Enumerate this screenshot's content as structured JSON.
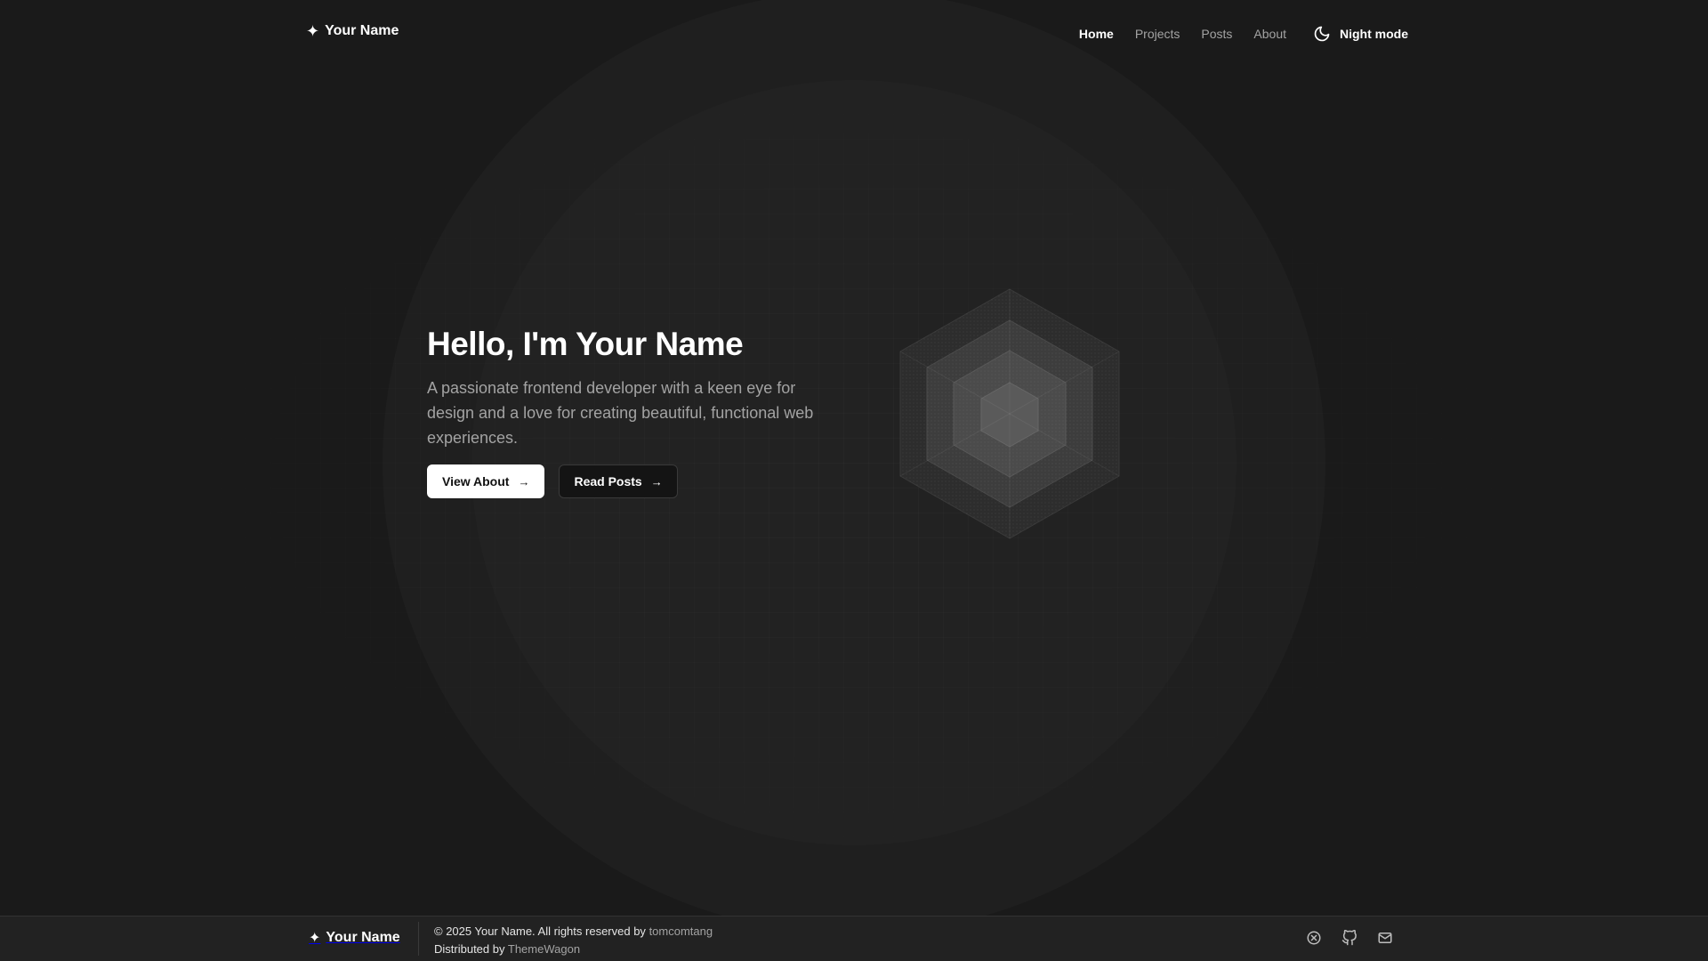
{
  "header": {
    "brand": "Your Name",
    "nav": [
      "Home",
      "Projects",
      "Posts",
      "About"
    ],
    "night_mode_label": "Night mode"
  },
  "hero": {
    "title": "Hello, I'm Your Name",
    "description": "A passionate frontend developer with a keen eye for design and a love for creating beautiful, functional web experiences.",
    "primary_button": "View About",
    "secondary_button": "Read Posts"
  },
  "footer": {
    "brand": "Your Name",
    "copyright_prefix": "© 2025 Your Name. All rights reserved by",
    "copyright_link": "tomcomtang",
    "distributed_prefix": "Distributed by",
    "distributed_link": "ThemeWagon"
  },
  "icons": {
    "brand": "sparkle-icon",
    "night_mode": "moon-icon",
    "button_arrow": "arrow-right-icon",
    "social": [
      "x-icon",
      "github-icon",
      "mail-icon"
    ]
  },
  "colors": {
    "background": "#1a1a1a",
    "footer_background": "#222222",
    "muted_text": "#a3a3a3",
    "text": "#ffffff"
  }
}
